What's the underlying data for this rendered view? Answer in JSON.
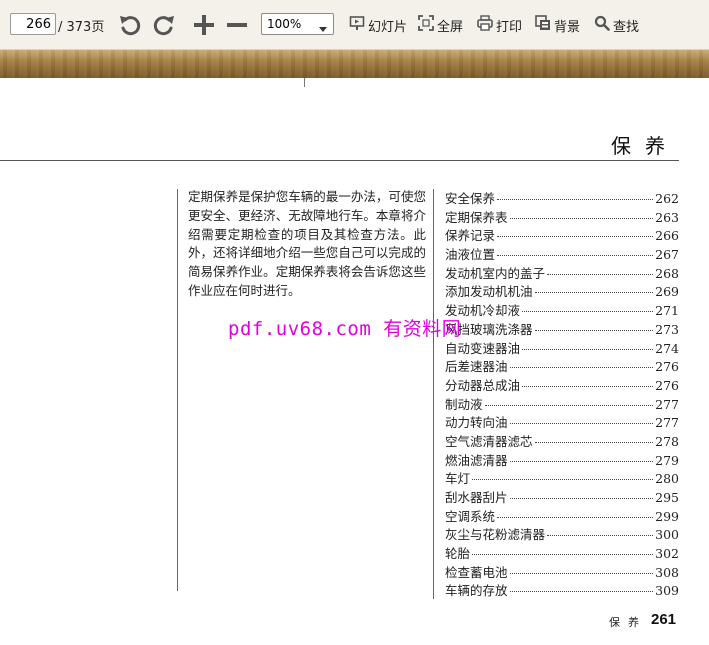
{
  "toolbar": {
    "page_number": "266",
    "page_total": "/ 373页",
    "zoom": "100%",
    "slideshow_label": "幻灯片",
    "fullscreen_label": "全屏",
    "print_label": "打印",
    "background_label": "背景",
    "search_label": "查找",
    "icons": {
      "rotate_ccw": "rotate-ccw-icon",
      "rotate_cw": "rotate-cw-icon",
      "zoom_in": "plus-icon",
      "zoom_out": "minus-icon",
      "slideshow": "slideshow-icon",
      "fullscreen": "fullscreen-icon",
      "print": "printer-icon",
      "background": "background-icon",
      "search": "magnifier-icon"
    },
    "colors": {
      "icon": "#555555",
      "wood": "#8a6832"
    }
  },
  "document": {
    "section_title": "保养",
    "intro_text": "定期保养是保护您车辆的最一办法，可使您更安全、更经济、无故障地行车。本章将介绍需要定期检查的项目及其检查方法。此外，还将详细地介绍一些您自己可以完成的简易保养作业。定期保养表将会告诉您这些作业应在何时进行。",
    "watermark": "pdf.uv68.com 有资料网",
    "watermark_color": "#e000e0",
    "toc": [
      {
        "title": "安全保养",
        "page": "262"
      },
      {
        "title": "定期保养表",
        "page": "263"
      },
      {
        "title": "保养记录",
        "page": "266"
      },
      {
        "title": "油液位置",
        "page": "267"
      },
      {
        "title": "发动机室内的盖子",
        "page": "268"
      },
      {
        "title": "添加发动机机油",
        "page": "269"
      },
      {
        "title": "发动机冷却液",
        "page": "271"
      },
      {
        "title": "风挡玻璃洗涤器",
        "page": "273"
      },
      {
        "title": "自动变速器油",
        "page": "274"
      },
      {
        "title": "后差速器油",
        "page": "276"
      },
      {
        "title": "分动器总成油",
        "page": "276"
      },
      {
        "title": "制动液",
        "page": "277"
      },
      {
        "title": "动力转向油",
        "page": "277"
      },
      {
        "title": "空气滤清器滤芯",
        "page": "278"
      },
      {
        "title": "燃油滤清器",
        "page": "279"
      },
      {
        "title": "车灯",
        "page": "280"
      },
      {
        "title": "刮水器刮片",
        "page": "295"
      },
      {
        "title": "空调系统",
        "page": "299"
      },
      {
        "title": "灰尘与花粉滤清器",
        "page": "300"
      },
      {
        "title": "轮胎",
        "page": "302"
      },
      {
        "title": "检查蓄电池",
        "page": "308"
      },
      {
        "title": "车辆的存放",
        "page": "309"
      }
    ],
    "footer_label": "保养",
    "footer_page": "261"
  }
}
